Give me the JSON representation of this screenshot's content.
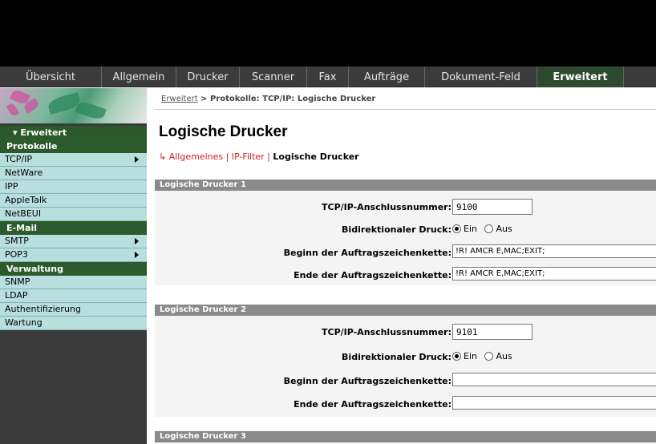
{
  "tabs": [
    {
      "label": "Übersicht",
      "active": false
    },
    {
      "label": "Allgemein",
      "active": false
    },
    {
      "label": "Drucker",
      "active": false
    },
    {
      "label": "Scanner",
      "active": false
    },
    {
      "label": "Fax",
      "active": false
    },
    {
      "label": "Aufträge",
      "active": false
    },
    {
      "label": "Dokument-Feld",
      "active": false
    },
    {
      "label": "Erweitert",
      "active": true
    }
  ],
  "sidebar": {
    "header": "▾ Erweitert",
    "sections": [
      {
        "title": "Protokolle",
        "items": [
          "TCP/IP",
          "NetWare",
          "IPP",
          "AppleTalk",
          "NetBEUI"
        ]
      },
      {
        "title": "E-Mail",
        "items": [
          "SMTP",
          "POP3"
        ]
      },
      {
        "title": "Verwaltung",
        "items": [
          "SNMP",
          "LDAP",
          "Authentifizierung",
          "Wartung"
        ]
      }
    ]
  },
  "breadcrumb": {
    "link": "Erweitert",
    "rest": " > Protokolle: TCP/IP: Logische Drucker"
  },
  "page_title": "Logische Drucker",
  "subnav": {
    "prefix": "↳ ",
    "items": [
      "Allgemeines",
      "IP-Filter"
    ],
    "separator": " | ",
    "current": "Logische Drucker"
  },
  "labels": {
    "port": "TCP/IP-Anschlussnummer:",
    "bidi": "Bidirektionaler Druck:",
    "begin": "Beginn der Auftragszeichenkette:",
    "end": "Ende der Auftragszeichenkette:",
    "on": "Ein",
    "off": "Aus"
  },
  "printers": [
    {
      "title": "Logische Drucker 1",
      "port": "9100",
      "bidi": "Ein",
      "begin": "!R! AMCR E,MAC;EXIT;",
      "end": "!R! AMCR E,MAC;EXIT;"
    },
    {
      "title": "Logische Drucker 2",
      "port": "9101",
      "bidi": "Ein",
      "begin": "",
      "end": ""
    },
    {
      "title": "Logische Drucker 3"
    }
  ]
}
